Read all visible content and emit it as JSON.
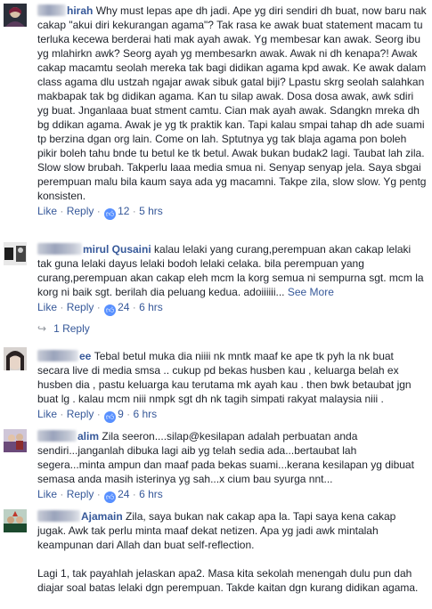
{
  "comments": [
    {
      "name_visible": "hirah",
      "text": "Why must lepas ape dh jadi. Ape yg diri sendiri dh buat, now baru nak cakap \"akui diri kekurangan agama\"? Tak rasa ke awak buat statement macam tu terluka kecewa berderai hati mak ayah awak. Yg membesar kan awak. Seorg ibu yg mlahirkn awk? Seorg ayah yg membesarkn awak. Awak ni dh kenapa?! Awak cakap macamtu seolah mereka tak bagi didikan agama kpd awak. Ke awak dalam class agama dlu ustzah ngajar awak sibuk gatal biji? Lpastu skrg seolah salahkan makbapak tak bg didikan agama. Kan tu silap awak. Dosa dosa awak, awk sdiri yg buat. Jnganlaaa buat stment camtu. Cian mak ayah awak. Sdangkn mreka dh bg ddikan agama. Awak je yg tk praktik kan. Tapi kalau smpai tahap dh ade suami tp berzina dgan org lain. Come on lah. Sptutnya yg tak blaja agama pon boleh pikir boleh tahu bnde tu betul ke tk betul. Awak bukan budak2 lagi. Taubat lah zila. Slow slow brubah. Takperlu laaa media smua ni. Senyap senyap jela. Saya sbgai perempuan malu bila kaum saya ada yg macamni. Takpe zila, slow slow. Yg pentg konsisten.",
      "like": "Like",
      "reply": "Reply",
      "likes": "12",
      "time": "5 hrs"
    },
    {
      "name_visible": "mirul Qusaini",
      "text": "kalau lelaki yang curang,perempuan akan cakap lelaki tak guna lelaki dayus lelaki bodoh lelaki celaka. bila perempuan yang curang,perempuan akan cakap eleh mcm la korg semua ni sempurna sgt. mcm la korg ni baik sgt. berilah dia peluang kedua. adoiiiiii...",
      "see_more": "See More",
      "like": "Like",
      "reply": "Reply",
      "likes": "24",
      "time": "6 hrs",
      "replies_link": "1 Reply"
    },
    {
      "name_visible": "ee",
      "text": "Tebal betul muka dia niiii nk mntk maaf ke ape tk pyh la nk buat secara live di media smsa .. cukup pd bekas husben kau , keluarga belah ex husben dia , pastu keluarga kau terutama mk ayah kau . then bwk betaubat jgn buat lg . kalau mcm niii nmpk sgt dh nk tagih simpati rakyat malaysia niii .",
      "like": "Like",
      "reply": "Reply",
      "likes": "9",
      "time": "6 hrs"
    },
    {
      "name_visible": "alim",
      "text": "Zila seeron....silap@kesilapan adalah perbuatan anda sendiri...janganlah dibuka lagi aib yg telah sedia ada...bertaubat lah segera...minta ampun dan maaf pada bekas suami...kerana kesilapan yg dibuat semasa anda masih isterinya yg sah...x cium bau syurga nnt...",
      "like": "Like",
      "reply": "Reply",
      "likes": "24",
      "time": "6 hrs"
    },
    {
      "name_visible": "Ajamain",
      "text": "Zila, saya bukan nak cakap apa la. Tapi saya kena cakap jugak. Awk tak perlu minta maaf dekat netizen. Apa yg jadi awk mintalah keampunan dari Allah dan buat self-reflection.",
      "text2": "Lagi 1, tak payahlah jelaskan apa2. Masa kita sekolah menengah dulu pun dah diajar soal batas lelaki dgn perempuan. Takde kaitan dgn kurang didikan agama."
    }
  ],
  "separator": "·",
  "like_icon": "thumbs-up-icon",
  "reply_arrow_icon": "reply-arrow-icon",
  "colors": {
    "link": "#365899",
    "meta": "#90949c",
    "text": "#1d2129",
    "like_badge": "#5890ff"
  }
}
